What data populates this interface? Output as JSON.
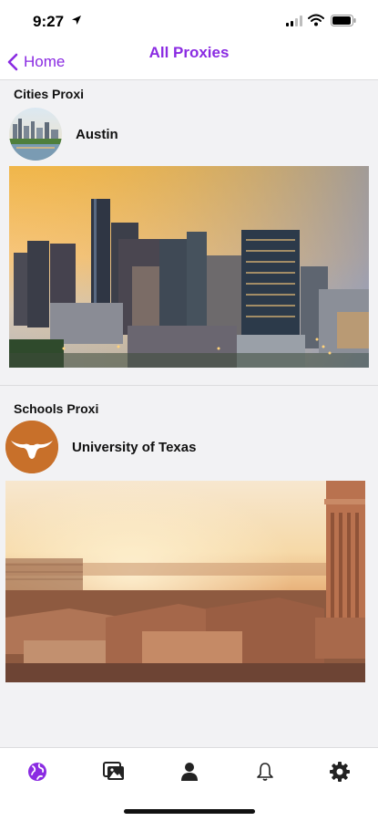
{
  "status_bar": {
    "time": "9:27"
  },
  "nav": {
    "back_label": "Home",
    "title": "All Proxies"
  },
  "sections": [
    {
      "title": "Cities Proxi",
      "item": {
        "name": "Austin",
        "avatar": "austin-skyline-thumbnail",
        "image": "austin-skyline-photo"
      }
    },
    {
      "title": "Schools Proxi",
      "item": {
        "name": "University of Texas",
        "avatar": "longhorn-logo",
        "image": "ut-campus-sunset-photo"
      }
    }
  ],
  "tabs": [
    {
      "icon": "globe-icon",
      "active": true
    },
    {
      "icon": "photos-icon",
      "active": false
    },
    {
      "icon": "person-icon",
      "active": false
    },
    {
      "icon": "bell-icon",
      "active": false
    },
    {
      "icon": "gear-icon",
      "active": false
    }
  ],
  "colors": {
    "accent": "#8a2be2",
    "longhorn_orange": "#c8702a",
    "background": "#f2f2f4"
  }
}
